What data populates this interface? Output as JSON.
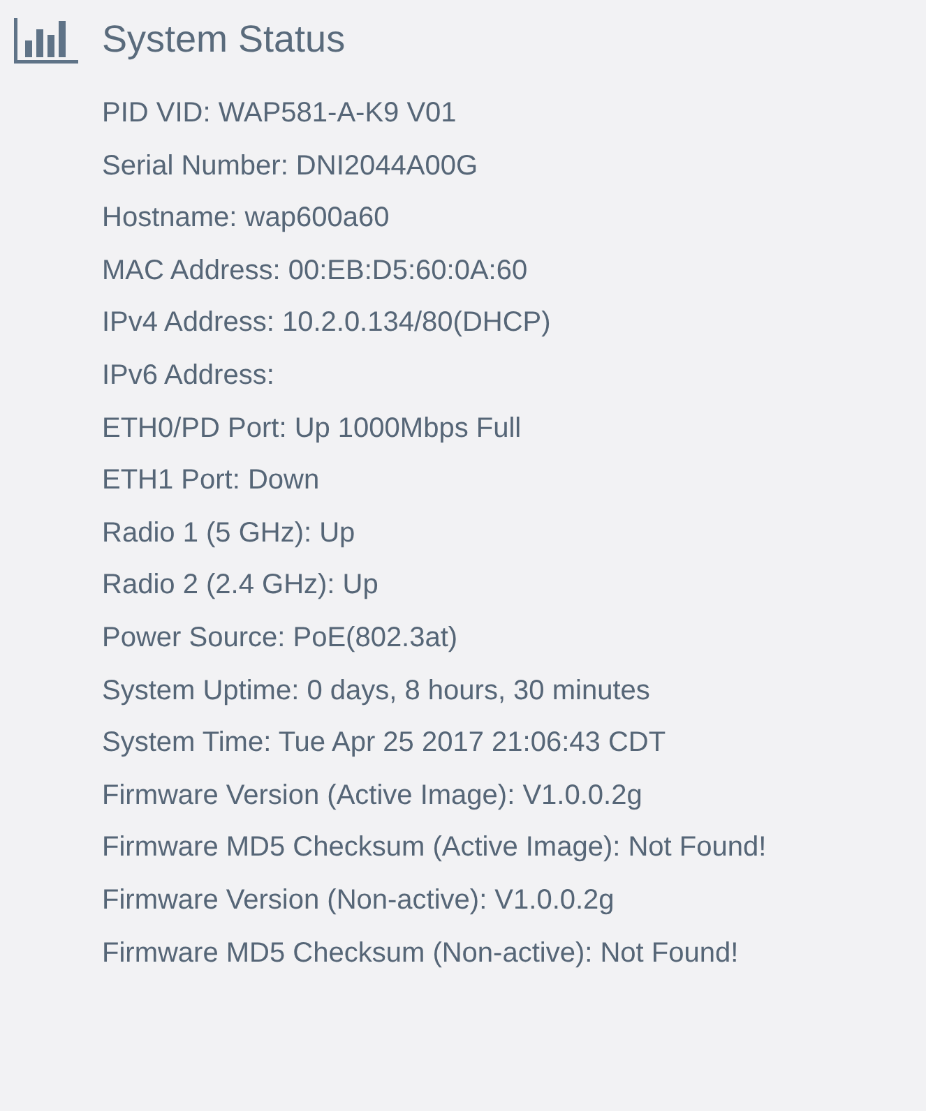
{
  "section": {
    "title": "System Status"
  },
  "lines": [
    {
      "text": "PID VID: WAP581-A-K9 V01"
    },
    {
      "text": "Serial Number: DNI2044A00G"
    },
    {
      "text": "Hostname: wap600a60"
    },
    {
      "text": "MAC Address: 00:EB:D5:60:0A:60"
    },
    {
      "text": "IPv4 Address: 10.2.0.134/80(DHCP)"
    },
    {
      "text": "IPv6 Address:"
    },
    {
      "text": "ETH0/PD Port: Up 1000Mbps Full"
    },
    {
      "text": "ETH1 Port: Down"
    },
    {
      "text": "Radio 1 (5 GHz): Up"
    },
    {
      "text": "Radio 2 (2.4 GHz): Up"
    },
    {
      "text": "Power Source: PoE(802.3at)"
    },
    {
      "text": "System Uptime: 0 days, 8 hours, 30 minutes"
    },
    {
      "text": "System Time: Tue Apr 25 2017 21:06:43 CDT"
    },
    {
      "text": "Firmware Version (Active Image): V1.0.0.2g"
    },
    {
      "text": "Firmware MD5 Checksum (Active Image): Not Found!"
    },
    {
      "text": "Firmware Version (Non-active): V1.0.0.2g"
    },
    {
      "text": "Firmware MD5 Checksum (Non-active): Not Found!"
    }
  ]
}
